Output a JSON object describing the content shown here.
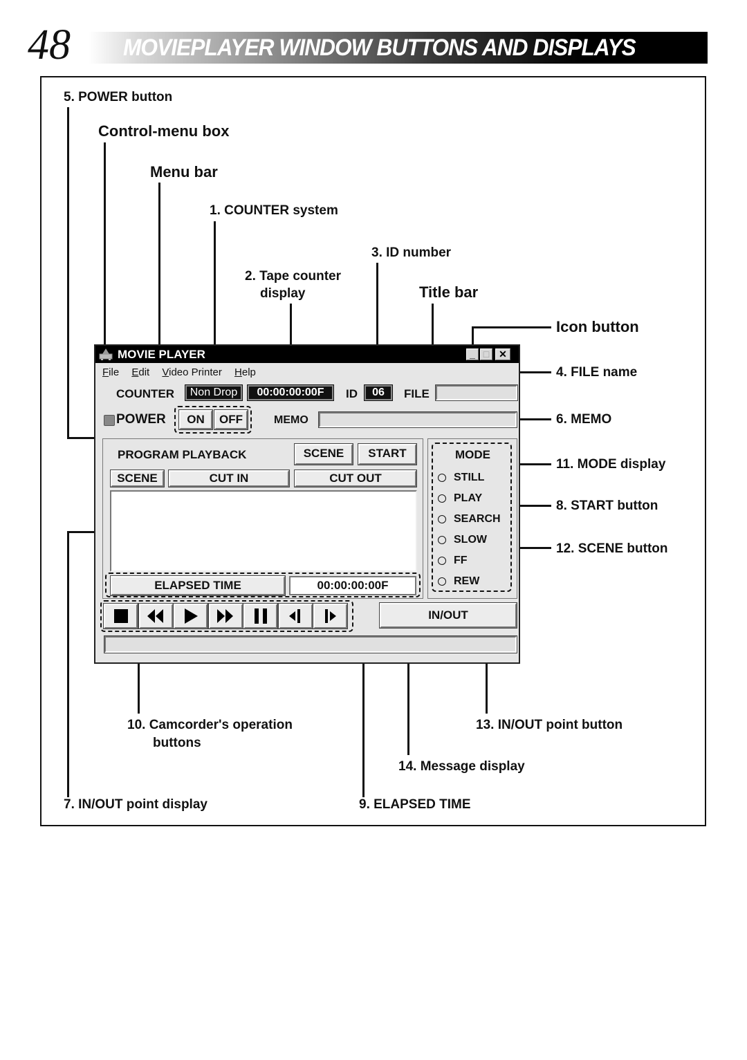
{
  "page": {
    "number": "48",
    "title": "MOVIEPLAYER WINDOW BUTTONS AND DISPLAYS"
  },
  "callouts": {
    "power_button": "5. POWER button",
    "control_menu_box": "Control-menu box",
    "menu_bar": "Menu bar",
    "counter_system": "1. COUNTER system",
    "id_number": "3. ID number",
    "tape_counter_line1": "2. Tape counter",
    "tape_counter_line2": "display",
    "title_bar": "Title bar",
    "icon_button": "Icon button",
    "file_name": "4. FILE name",
    "memo": "6. MEMO",
    "mode_display": "11. MODE display",
    "start_button": "8. START button",
    "scene_button": "12. SCENE button",
    "camcorder_buttons_line1": "10. Camcorder's operation",
    "camcorder_buttons_line2": "buttons",
    "inout_point_button": "13. IN/OUT point button",
    "message_display": "14. Message display",
    "inout_point_display": "7. IN/OUT point display",
    "elapsed_time": "9. ELAPSED TIME"
  },
  "window": {
    "title": "MOVIE PLAYER",
    "icons": {
      "app": "camcorder-icon",
      "minimize": "minimize-icon",
      "maximize": "maximize-icon",
      "close": "close-icon"
    },
    "menu": [
      {
        "accel": "F",
        "rest": "ile"
      },
      {
        "accel": "E",
        "rest": "dit"
      },
      {
        "accel": "V",
        "rest": "ideo Printer"
      },
      {
        "accel": "H",
        "rest": "elp"
      }
    ],
    "counter_label": "COUNTER",
    "counter_mode": "Non Drop",
    "tape_counter": "00:00:00:00F",
    "id_label": "ID",
    "id_value": "06",
    "file_label": "FILE",
    "file_value": "",
    "power_label": "POWER",
    "on_label": "ON",
    "off_label": "OFF",
    "memo_label": "MEMO",
    "memo_value": "",
    "program_playback_label": "PROGRAM PLAYBACK",
    "scene_button": "SCENE",
    "start_button": "START",
    "columns": [
      "SCENE",
      "CUT IN",
      "CUT OUT"
    ],
    "elapsed_label": "ELAPSED TIME",
    "elapsed_value": "00:00:00:00F",
    "mode": {
      "title": "MODE",
      "options": [
        "STILL",
        "PLAY",
        "SEARCH",
        "SLOW",
        "FF",
        "REW"
      ]
    },
    "transport": [
      "stop-icon",
      "rewind-icon",
      "play-icon",
      "fast-forward-icon",
      "pause-icon",
      "frame-back-icon",
      "frame-forward-icon"
    ],
    "inout_button": "IN/OUT",
    "message": ""
  }
}
